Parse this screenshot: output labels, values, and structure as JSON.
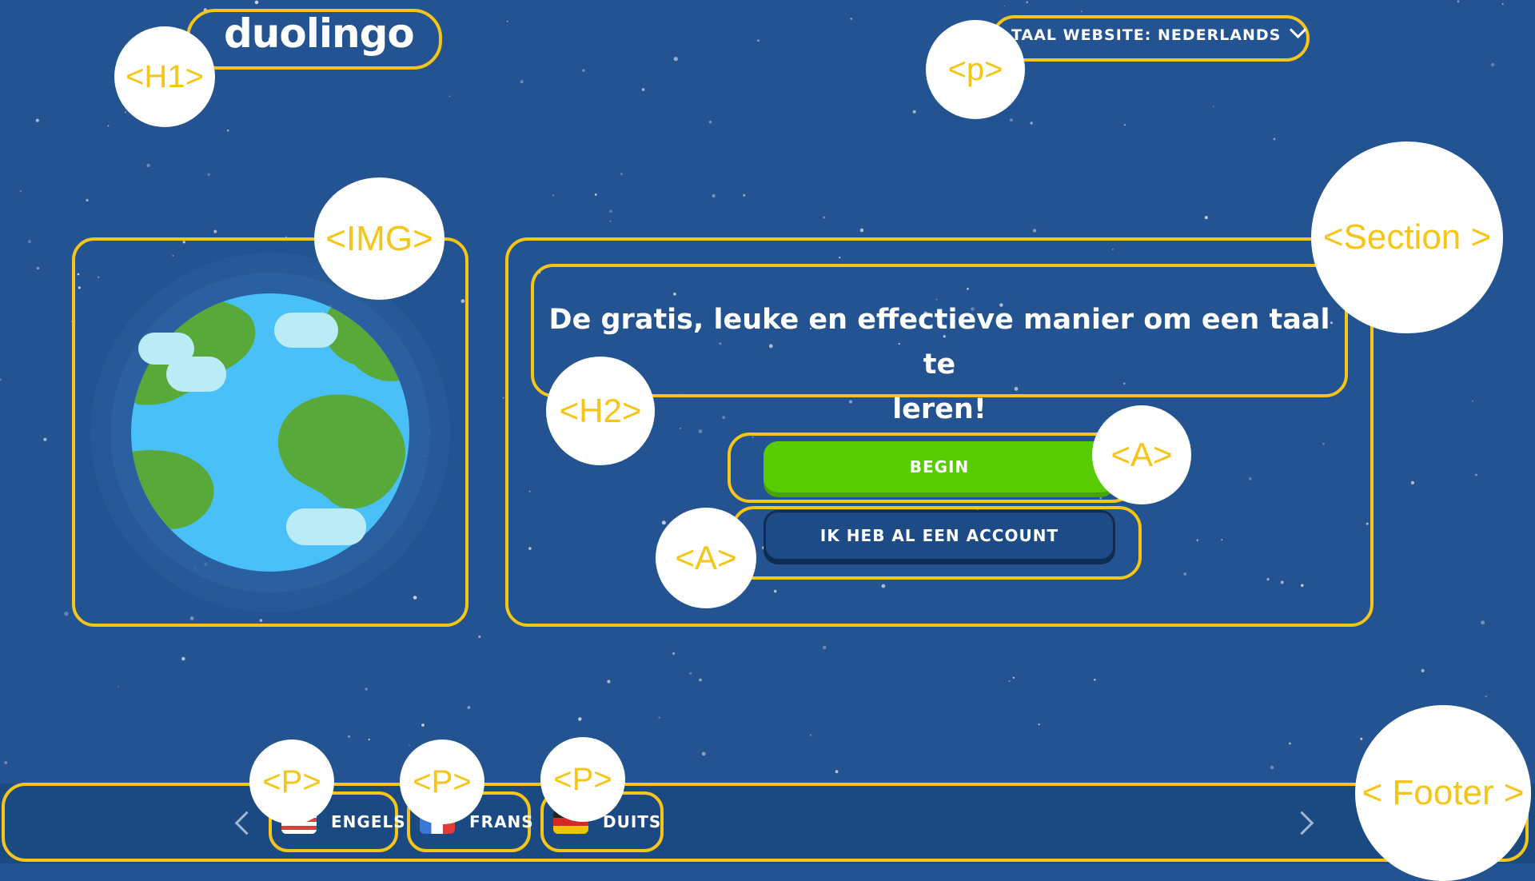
{
  "header": {
    "logo": "duolingo",
    "site_language_label": "TAAL WEBSITE: NEDERLANDS"
  },
  "hero": {
    "headline_line1": "De gratis, leuke en effectieve manier om een taal te",
    "headline_line2": "leren!",
    "begin_button": "BEGIN",
    "login_button": "IK HEB AL EEN ACCOUNT"
  },
  "footer": {
    "languages": [
      {
        "label": "ENGELS",
        "flag": "us-flag-icon"
      },
      {
        "label": "FRANS",
        "flag": "france-flag-icon"
      },
      {
        "label": "DUITS",
        "flag": "germany-flag-icon"
      }
    ]
  },
  "annotations": {
    "h1": "<H1>",
    "p_site": "<p>",
    "img": "<IMG>",
    "section": "<Section >",
    "h2": "<H2>",
    "a_begin": "<A>",
    "a_account": "<A>",
    "p_en": "<P>",
    "p_fr": "<P>",
    "p_de": "<P>",
    "footer": "< Footer >"
  },
  "colors": {
    "background": "#235390",
    "footer": "#1b4a83",
    "outline": "#f5c518",
    "begin_button": "#58cc02",
    "globe_ocean": "#49c0f8",
    "globe_land": "#58a83a",
    "globe_cloud": "#b9ecf7"
  },
  "icons": [
    "globe-illustration",
    "chevron-down-icon",
    "chevron-left-icon",
    "chevron-right-icon"
  ]
}
